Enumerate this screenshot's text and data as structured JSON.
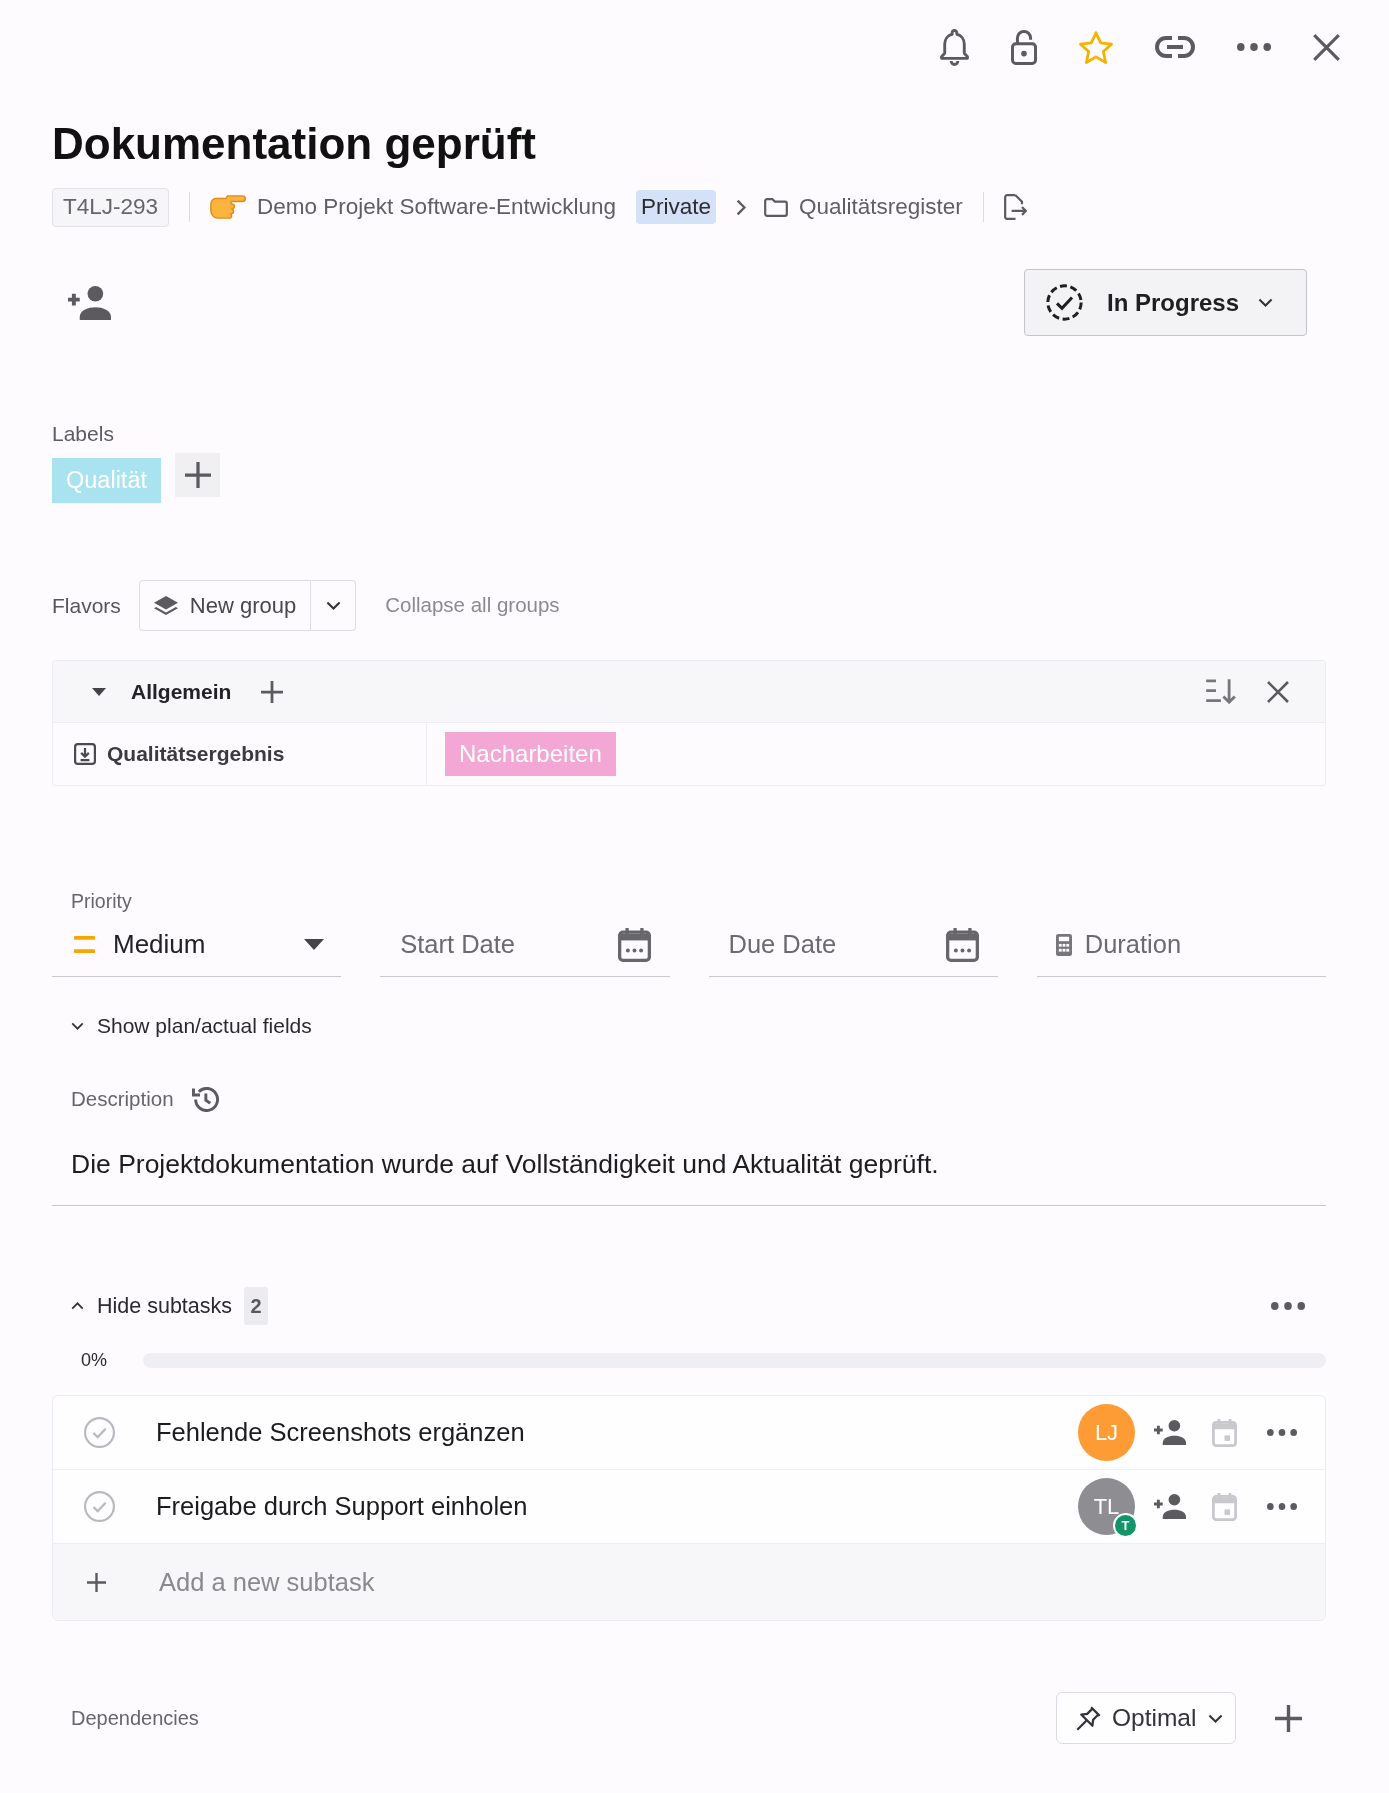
{
  "header": {
    "favorite": true
  },
  "task": {
    "title": "Dokumentation geprüft",
    "id": "T4LJ-293",
    "project": "Demo Projekt Software-Entwicklung",
    "visibility": "Private",
    "folder": "Qualitätsregister",
    "status": "In Progress"
  },
  "labels": {
    "title": "Labels",
    "items": [
      {
        "name": "Qualität",
        "color": "#a9e3f0"
      }
    ]
  },
  "flavors": {
    "title": "Flavors",
    "new_group": "New group",
    "collapse_all": "Collapse all groups",
    "groups": [
      {
        "name": "Allgemein",
        "expanded": true,
        "fields": [
          {
            "name": "Qualitätsergebnis",
            "value": "Nacharbeiten",
            "color": "#f2a7d5"
          }
        ]
      }
    ]
  },
  "fields": {
    "priority": {
      "label": "Priority",
      "value": "Medium"
    },
    "start_date": {
      "placeholder": "Start Date"
    },
    "due_date": {
      "placeholder": "Due Date"
    },
    "duration": {
      "placeholder": "Duration"
    }
  },
  "plan_fields": {
    "label": "Show plan/actual fields",
    "expanded": false
  },
  "description": {
    "label": "Description",
    "text": "Die Projektdokumentation wurde auf Vollständigkeit und Aktualität geprüft."
  },
  "subtasks": {
    "toggle": "Hide subtasks",
    "count": "2",
    "expanded": true,
    "progress": "0%",
    "level": 0,
    "items": [
      {
        "title": "Fehlende Screenshots ergänzen",
        "done": false,
        "assignee": {
          "initials": "LJ",
          "color": "#fd9b34"
        }
      },
      {
        "title": "Freigabe durch Support einholen",
        "done": false,
        "assignee": {
          "initials": "TL",
          "color": "#8e8d92",
          "badge": "T"
        }
      }
    ],
    "add_placeholder": "Add a new subtask"
  },
  "dependencies": {
    "label": "Dependencies",
    "mode": "Optimal"
  }
}
